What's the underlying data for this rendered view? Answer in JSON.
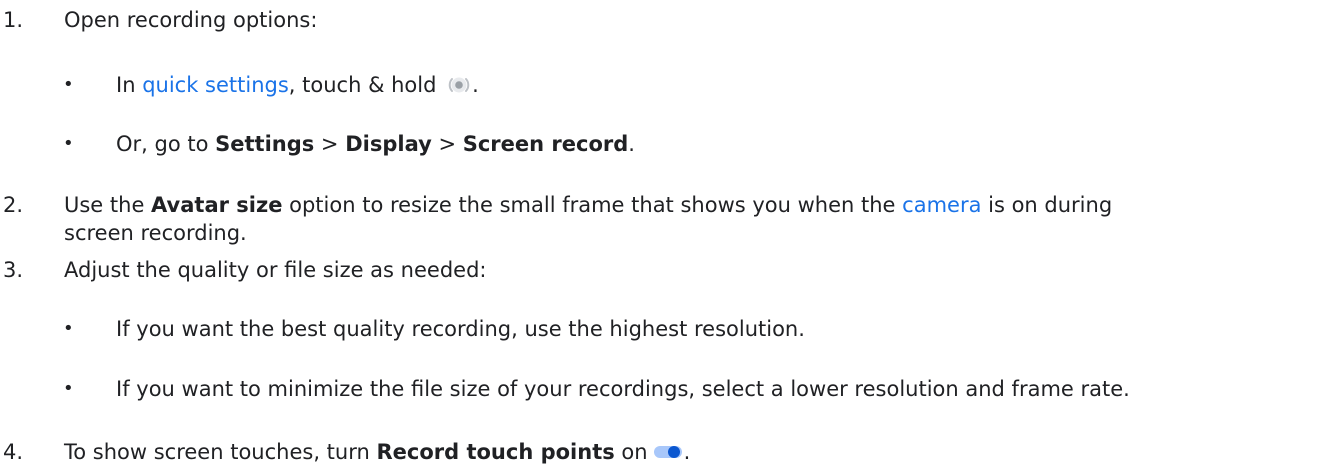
{
  "steps": [
    {
      "number": "1.",
      "text": "Open recording options:",
      "bullets": [
        {
          "prefix": "In ",
          "link": "quick settings",
          "middle": ", touch & hold ",
          "icon": "screen-record-icon",
          "suffix": "."
        },
        {
          "prefix": "Or, go to ",
          "settings": "Settings",
          "sep1": " > ",
          "display": "Display",
          "sep2": " > ",
          "screen_record": "Screen record",
          "suffix": "."
        }
      ]
    },
    {
      "number": "2.",
      "prefix": "Use the ",
      "bold": "Avatar size",
      "middle": " option to resize the small frame that shows you when the ",
      "link": "camera",
      "suffix": " is on during",
      "line2": "screen recording."
    },
    {
      "number": "3.",
      "text": "Adjust the quality or file size as needed:",
      "bullets": [
        "If you want the best quality recording, use the highest resolution.",
        "If you want to minimize the file size of your recordings, select a lower resolution and frame rate."
      ]
    },
    {
      "number": "4.",
      "prefix": "To show screen touches, turn ",
      "bold": "Record touch points",
      "middle": " on",
      "icon": "toggle-on-icon",
      "suffix": "."
    }
  ],
  "bullet_char": "•",
  "colors": {
    "text": "#202124",
    "link": "#1a73e8",
    "toggle_track": "#a8c7fa",
    "toggle_thumb": "#0b57d0",
    "icon_gray": "#9aa0a6"
  }
}
